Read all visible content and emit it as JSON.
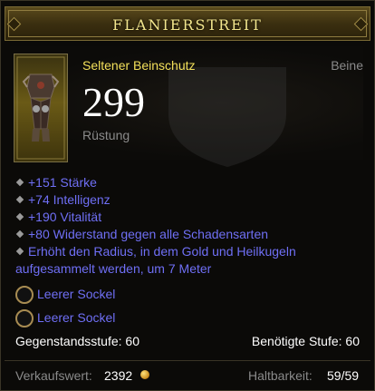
{
  "item": {
    "name": "FLANIERSTREIT",
    "type": "Seltener Beinschutz",
    "slot": "Beine",
    "armor_value": "299",
    "armor_label": "Rüstung",
    "icon": "leg-armor-icon"
  },
  "affixes": [
    "+151 Stärke",
    "+74 Intelligenz",
    "+190 Vitalität",
    "+80 Widerstand gegen alle Schadensarten",
    "Erhöht den Radius, in dem Gold und Heilkugeln",
    "aufgesammelt werden, um 7 Meter"
  ],
  "sockets": [
    "Leerer Sockel",
    "Leerer Sockel"
  ],
  "levels": {
    "item_level": "Gegenstandsstufe: 60",
    "required_level": "Benötigte Stufe: 60"
  },
  "footer": {
    "sell_label": "Verkaufswert:",
    "sell_value": "2392",
    "durability_label": "Haltbarkeit:",
    "durability_value": "59/59"
  },
  "colors": {
    "title": "#f3e68d",
    "rare_type": "#f3e05a",
    "affix": "#6f6ff5",
    "muted": "#8a8a8a"
  }
}
